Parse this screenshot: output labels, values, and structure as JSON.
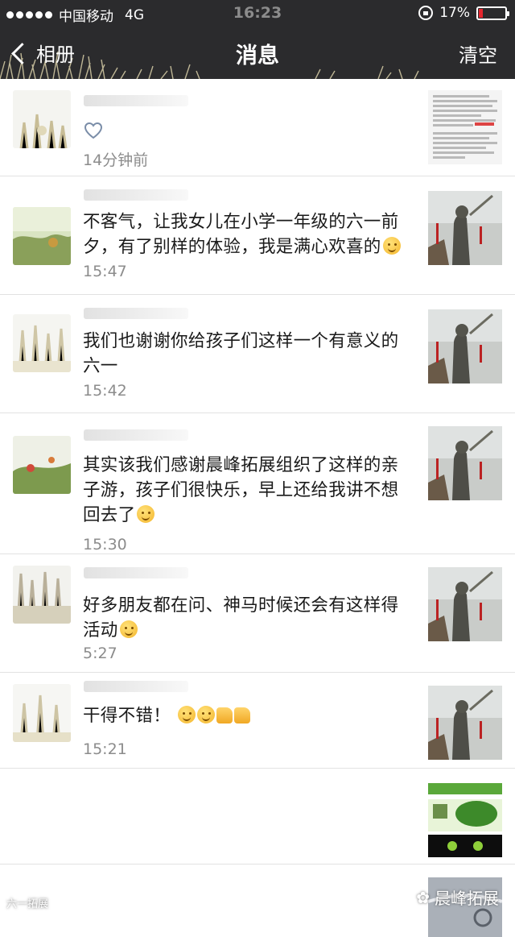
{
  "status_bar": {
    "carrier": "中国移动",
    "network": "4G",
    "time": "16:23",
    "battery": "17%"
  },
  "nav": {
    "back_label": "相册",
    "title": "消息",
    "clear_label": "清空"
  },
  "messages": [
    {
      "type": "like",
      "time": "14分钟前"
    },
    {
      "type": "comment",
      "text": "不客气，让我女儿在小学一年级的六一前夕，有了别样的体验，我是满心欢喜的",
      "time": "15:47"
    },
    {
      "type": "comment",
      "text": "我们也谢谢你给孩子们这样一个有意义的六一",
      "time": "15:42"
    },
    {
      "type": "comment",
      "text": "其实该我们感谢晨峰拓展组织了这样的亲子游，孩子们很快乐，早上还给我讲不想回去了",
      "time": "15:30"
    },
    {
      "type": "comment",
      "text": "好多朋友都在问、神马时候还会有这样得活动",
      "time": "5:27"
    },
    {
      "type": "comment",
      "text": "干得不错！",
      "time": "15:21"
    }
  ],
  "watermark": "晨峰拓展",
  "corner_watermark": "六一拓展"
}
